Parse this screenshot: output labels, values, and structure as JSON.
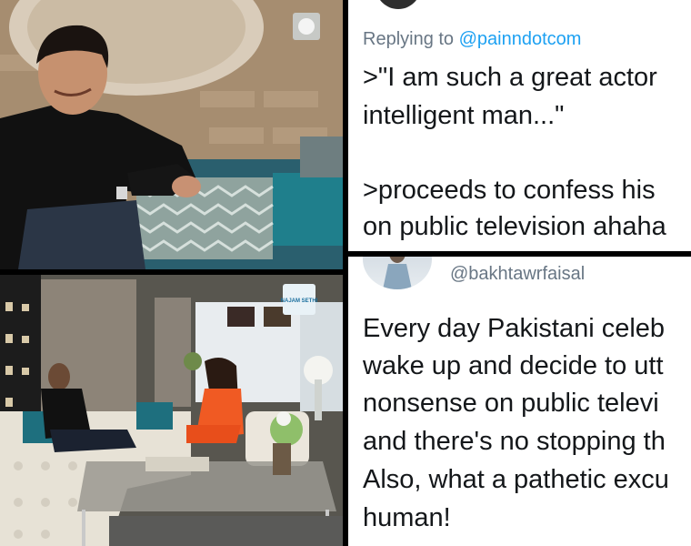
{
  "tweet_top": {
    "reply_prefix": "Replying to",
    "reply_handle": "@painndotcom",
    "lines": [
      ">\"I am such a great actor",
      "intelligent man...\"",
      "",
      ">proceeds to confess his",
      "on public television ahaha"
    ]
  },
  "tweet_bottom": {
    "username": "@bakhtawrfaisal",
    "lines": [
      "Every day Pakistani celeb",
      "wake up and decide to utt",
      "nonsense on public televi",
      "and there's no stopping th",
      "Also, what a pathetic excu",
      "human!"
    ]
  },
  "photo_bottom": {
    "logo_text": "NAJAM SETHI"
  },
  "colors": {
    "link": "#1da1f2",
    "muted": "#687684",
    "text": "#14171a"
  }
}
